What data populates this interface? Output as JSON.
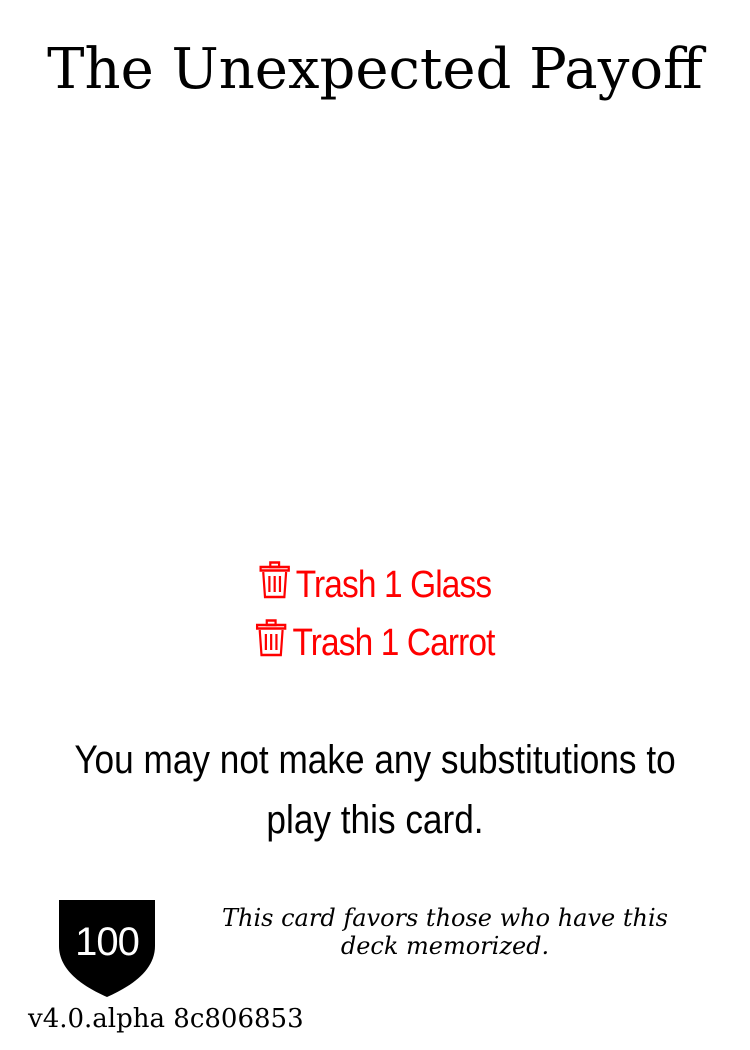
{
  "card": {
    "title": "The Unexpected Payoff",
    "costs": [
      {
        "icon": "trash-icon",
        "text": "Trash 1 Glass"
      },
      {
        "icon": "trash-icon",
        "text": "Trash 1 Carrot"
      }
    ],
    "rules_text": "You may not make any substitutions to play this card.",
    "shield_value": "100",
    "flavor_text": "This card favors those who have this deck memorized.",
    "version": "v4.0.alpha 8c806853"
  },
  "colors": {
    "cost": "#ff0000",
    "text": "#000000",
    "shield": "#000000",
    "background": "#ffffff"
  }
}
